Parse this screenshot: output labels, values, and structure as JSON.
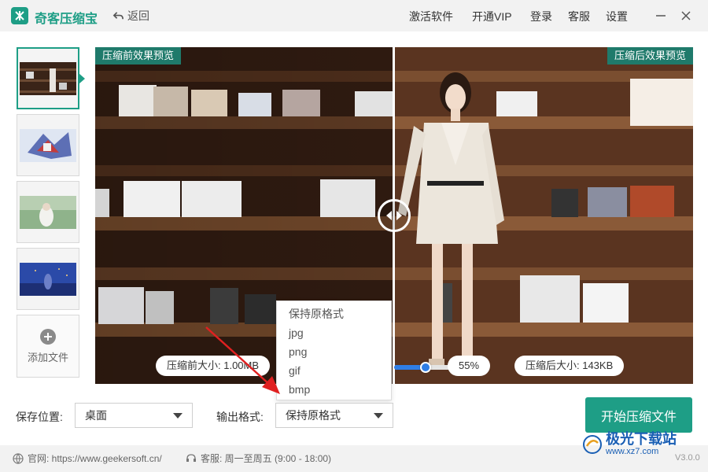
{
  "app": {
    "title": "奇客压缩宝",
    "back_label": "返回"
  },
  "top_menu": {
    "activate": "激活软件",
    "vip": "开通VIP",
    "login": "登录",
    "service": "客服",
    "settings": "设置"
  },
  "add_file_label": "添加文件",
  "preview": {
    "before_tag": "压缩前效果预览",
    "after_tag": "压缩后效果预览",
    "before_size": "压缩前大小: 1.00MB",
    "after_size": "压缩后大小: 143KB",
    "quality_percent": "55%",
    "quality_value": 0.55
  },
  "format_dropdown": {
    "options": [
      "保持原格式",
      "jpg",
      "png",
      "gif",
      "bmp"
    ]
  },
  "save_location": {
    "label": "保存位置:",
    "value": "桌面"
  },
  "output_format": {
    "label": "输出格式:",
    "value": "保持原格式"
  },
  "start_button": "开始压缩文件",
  "footer": {
    "website": "官网:  https://www.geekersoft.cn/",
    "service": "客服:  周一至周五 (9:00 - 18:00)"
  },
  "watermark": {
    "line1": "极光下载站",
    "line2": "www.xz7.com"
  },
  "version": "V3.0.0",
  "colors": {
    "brand": "#1e9e86",
    "tag_bg": "#1f7a6b",
    "slider": "#2f7ee6",
    "arrow": "#e02020"
  }
}
